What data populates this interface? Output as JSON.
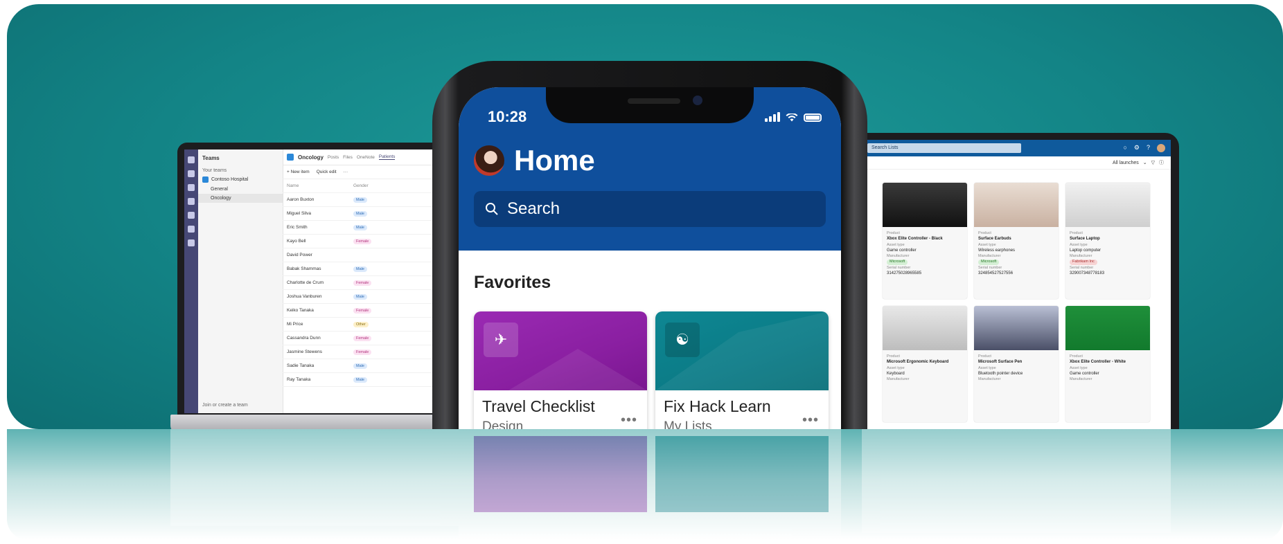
{
  "phone": {
    "time": "10:28",
    "title": "Home",
    "search_placeholder": "Search",
    "section_title": "Favorites",
    "cards": [
      {
        "title": "Travel Checklist",
        "subtitle": "Design",
        "icon": "airplane-icon",
        "color": "#8a1fa1"
      },
      {
        "title": "Fix Hack Learn",
        "subtitle": "My Lists",
        "icon": "palette-icon",
        "color": "#0b7b86"
      }
    ],
    "more_label": "•••"
  },
  "laptop": {
    "teams_header": "Teams",
    "your_teams": "Your teams",
    "team_name": "Contoso Hospital",
    "channels": [
      "General",
      "Oncology"
    ],
    "join_label": "Join or create a team",
    "list_title": "Oncology",
    "tabs": [
      "Posts",
      "Files",
      "OneNote",
      "Patients"
    ],
    "toolbar": [
      "+ New item",
      "Quick edit",
      "···"
    ],
    "columns": [
      "Name",
      "Gender"
    ],
    "rows": [
      {
        "name": "Aaron Buxton",
        "tag": "Male"
      },
      {
        "name": "Miguel Silva",
        "tag": "Male"
      },
      {
        "name": "Eric Smith",
        "tag": "Male"
      },
      {
        "name": "Kayo Bell",
        "tag": "Female"
      },
      {
        "name": "David Power",
        "tag": ""
      },
      {
        "name": "Babak Shammas",
        "tag": "Male"
      },
      {
        "name": "Charlotte de Crum",
        "tag": "Female"
      },
      {
        "name": "Joshua Vanburen",
        "tag": "Male"
      },
      {
        "name": "Keiko Tanaka",
        "tag": "Female"
      },
      {
        "name": "Mi Price",
        "tag": "Other"
      },
      {
        "name": "Cassandra Dunn",
        "tag": "Female"
      },
      {
        "name": "Jasmine Stewens",
        "tag": "Female"
      },
      {
        "name": "Sadie Tanaka",
        "tag": "Male"
      },
      {
        "name": "Ray Tanaka",
        "tag": "Male"
      }
    ]
  },
  "tablet": {
    "search_placeholder": "Search Lists",
    "view_label": "All launches",
    "cards": [
      {
        "product_label": "Product",
        "name": "Xbox Elite Controller - Black",
        "type_label": "Asset type",
        "type": "Game controller",
        "mfr_label": "Manufacturer",
        "mfr": "Microsoft",
        "serial_label": "Serial number",
        "serial": "314275028965585"
      },
      {
        "product_label": "Product",
        "name": "Surface Earbuds",
        "type_label": "Asset type",
        "type": "Wireless earphones",
        "mfr_label": "Manufacturer",
        "mfr": "Microsoft",
        "serial_label": "Serial number",
        "serial": "324854527527556"
      },
      {
        "product_label": "Product",
        "name": "Surface Laptop",
        "type_label": "Asset type",
        "type": "Laptop computer",
        "mfr_label": "Manufacturer",
        "mfr": "Fabrikam Inc",
        "serial_label": "Serial number",
        "serial": "329007348778183"
      },
      {
        "product_label": "Product",
        "name": "Microsoft Ergonomic Keyboard",
        "type_label": "Asset type",
        "type": "Keyboard",
        "mfr_label": "Manufacturer",
        "mfr": "",
        "serial_label": "",
        "serial": ""
      },
      {
        "product_label": "Product",
        "name": "Microsoft Surface Pen",
        "type_label": "Asset type",
        "type": "Bluetooth pointer device",
        "mfr_label": "Manufacturer",
        "mfr": "",
        "serial_label": "",
        "serial": ""
      },
      {
        "product_label": "Product",
        "name": "Xbox Elite Controller - White",
        "type_label": "Asset type",
        "type": "Game controller",
        "mfr_label": "Manufacturer",
        "mfr": "",
        "serial_label": "",
        "serial": ""
      }
    ]
  },
  "colors": {
    "background": "#138486",
    "phone_header": "#0f4f9c",
    "teams_rail": "#464775",
    "travel_card": "#8a1fa1",
    "hack_card": "#0b7b86"
  }
}
